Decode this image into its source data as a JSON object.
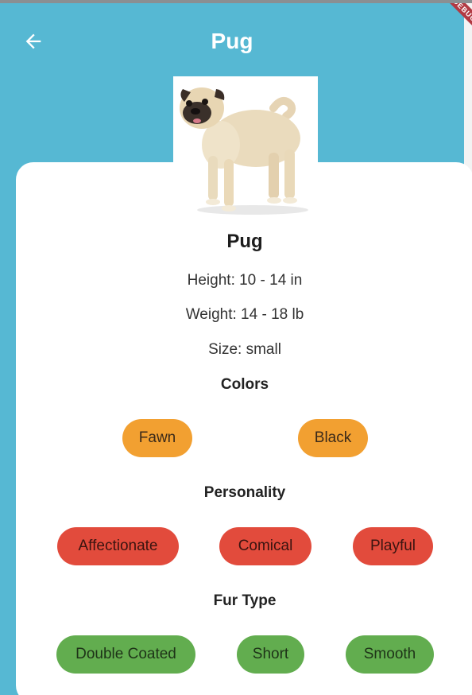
{
  "app_bar": {
    "title": "Pug",
    "debug_banner": "DEBUG"
  },
  "breed": {
    "name": "Pug",
    "height": "Height: 10 - 14 in",
    "weight": "Weight: 14 - 18 lb",
    "size": "Size: small"
  },
  "sections": {
    "colors": {
      "title": "Colors",
      "chips": [
        "Fawn",
        "Black"
      ]
    },
    "personality": {
      "title": "Personality",
      "chips": [
        "Affectionate",
        "Comical",
        "Playful"
      ]
    },
    "fur": {
      "title": "Fur Type",
      "chips": [
        "Double Coated",
        "Short",
        "Smooth"
      ]
    }
  },
  "icons": {
    "back": "arrow-left-icon",
    "photo": "pug-photo"
  },
  "colors": {
    "app_bar": "#56b8d3",
    "colors_chip": "#f2a031",
    "personality_chip": "#e24b3c",
    "fur_chip": "#62ad4f"
  }
}
